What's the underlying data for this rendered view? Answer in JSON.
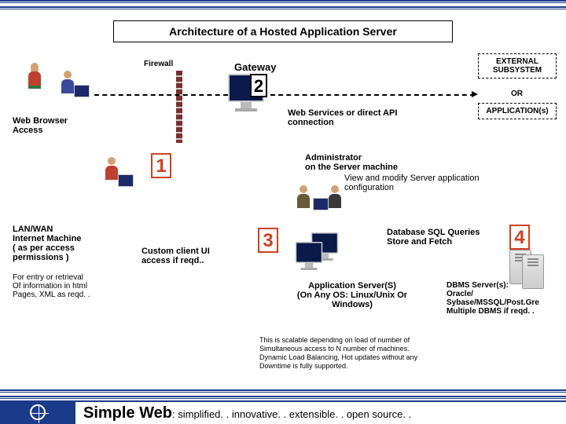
{
  "title": "Architecture of a Hosted Application Server",
  "firewall": "Firewall",
  "gateway": "Gateway",
  "external_box": "EXTERNAL SUBSYSTEM",
  "or": "OR",
  "applications_box": "APPLICATION(s)",
  "web_browser": {
    "l1": "Web Browser",
    "l2": "Access"
  },
  "web_services": {
    "l1": "Web Services or direct API",
    "l2": "connection"
  },
  "numbers": {
    "n1": "1",
    "n2": "2",
    "n3": "3",
    "n4": "4"
  },
  "admin": {
    "l1": "Administrator",
    "l2": "on the Server machine",
    "l3": "View and modify Server application",
    "l4": "configuration"
  },
  "lanwan": {
    "l1": "LAN/WAN",
    "l2": "Internet Machine",
    "l3": "( as per access",
    "l4": "permissions )"
  },
  "entry": {
    "l1": "For entry or retrieval",
    "l2": "Of information in html",
    "l3": "Pages, XML as reqd. ."
  },
  "custom": {
    "l1": "Custom client UI",
    "l2": "access if reqd.."
  },
  "appserver": {
    "l1": "Application Server(S)",
    "l2": "(On Any OS: Linux/Unix Or",
    "l3": "Windows)"
  },
  "dbquery": {
    "l1": "Database SQL Queries",
    "l2": "Store and Fetch"
  },
  "dbms": {
    "l1": "DBMS Server(s):",
    "l2": "Oracle/",
    "l3": "Sybase/MSSQL/Post.Gre",
    "l4": "Multiple DBMS if reqd. ."
  },
  "scale": {
    "l1": "This is scalable depending on load of number of",
    "l2": "Simultaneous access to N number of machines.",
    "l3": "Dynamic Load Balancing, Hot updates without any",
    "l4": "Downtime is fully supported."
  },
  "footer": {
    "brand": "Simple Web",
    "tag": ": simplified. . innovative. . extensible. . open source. ."
  }
}
